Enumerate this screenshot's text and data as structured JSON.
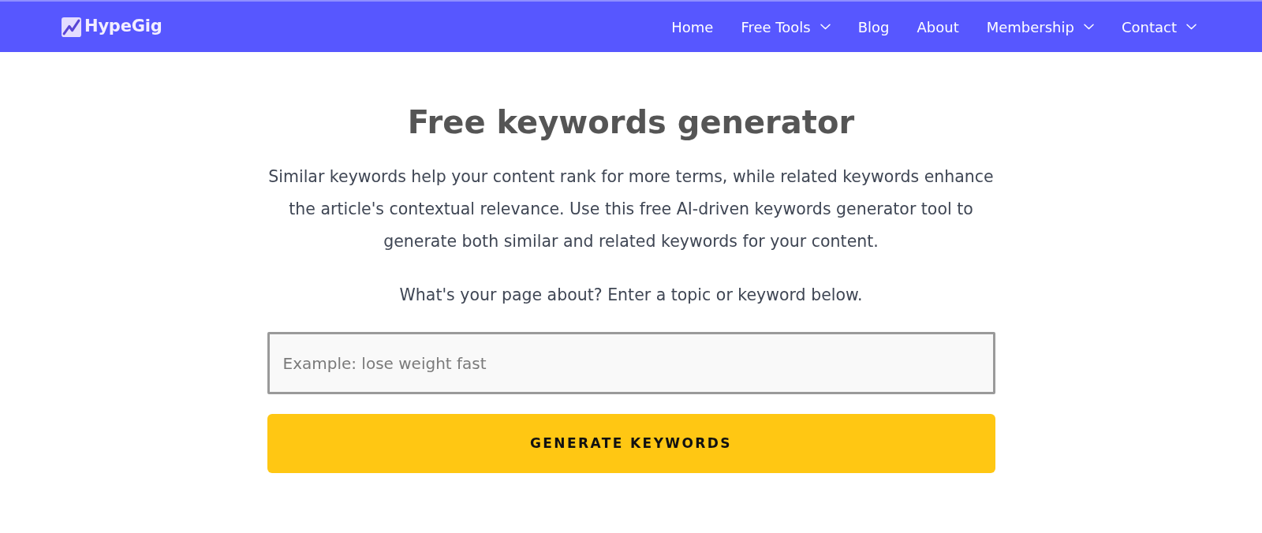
{
  "navbar": {
    "logo": {
      "text": "HypeGig"
    },
    "items": [
      {
        "label": "Home",
        "dropdown": false
      },
      {
        "label": "Free Tools",
        "dropdown": true
      },
      {
        "label": "Blog",
        "dropdown": false
      },
      {
        "label": "About",
        "dropdown": false
      },
      {
        "label": "Membership",
        "dropdown": true
      },
      {
        "label": "Contact",
        "dropdown": true
      }
    ]
  },
  "hero": {
    "title": "Free keywords generator",
    "description": "Similar keywords help your content rank for more terms, while related keywords enhance the article's contextual relevance. Use this free AI-driven keywords generator tool to generate both similar and related keywords for your content.",
    "prompt": "What's your page about? Enter a topic or keyword below."
  },
  "form": {
    "input": {
      "placeholder": "Example: lose weight fast"
    },
    "button": {
      "label": "GENERATE KEYWORDS"
    }
  }
}
